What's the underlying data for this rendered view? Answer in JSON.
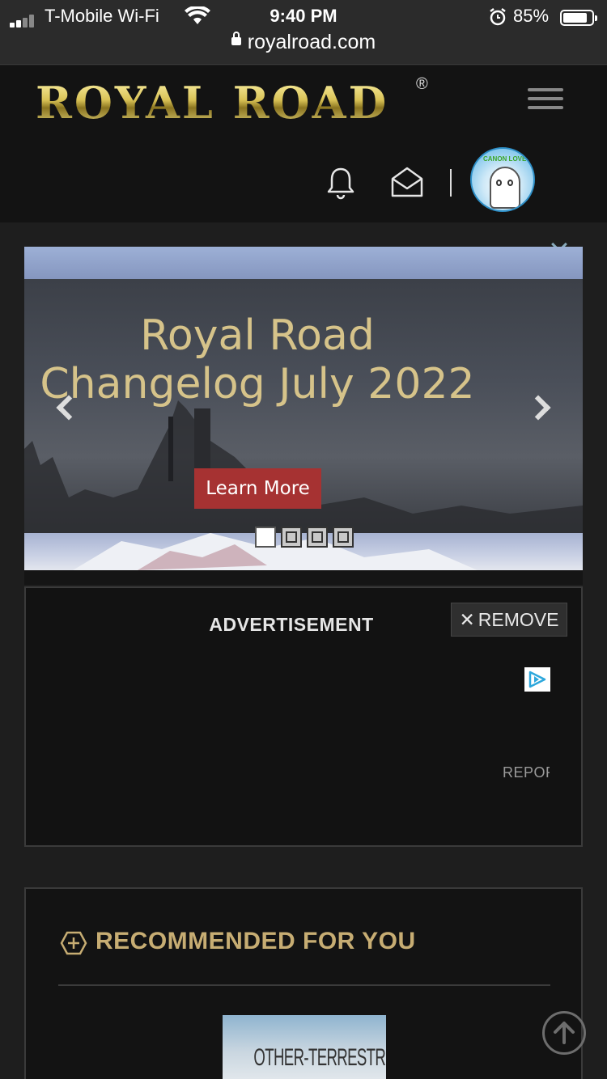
{
  "status_bar": {
    "carrier": "T-Mobile Wi-Fi",
    "time": "9:40 PM",
    "battery_percent": "85%",
    "battery_level": 0.85
  },
  "browser": {
    "url": "royalroad.com"
  },
  "header": {
    "logo_text": "ROYAL ROAD",
    "logo_mark": "®",
    "avatar_tag": "CANON LOVER"
  },
  "carousel": {
    "caption": "Royal Road Changelog July 2022",
    "button_label": "Learn More",
    "slide_count": 4,
    "active_slide": 1
  },
  "advertisement": {
    "title": "ADVERTISEMENT",
    "remove_label": "REMOVE",
    "report_label": "REPORT"
  },
  "recommended": {
    "title": "RECOMMENDED FOR YOU",
    "first_book_cover_text": "OTHER-TERRESTRIAL"
  },
  "colors": {
    "accent_gold": "#c7ad73",
    "button_red": "#a63232",
    "header_bg": "#131313",
    "page_bg": "#1e1e1e"
  },
  "icons": {
    "notification": "bell-icon",
    "messages": "envelope-icon",
    "menu": "hamburger-icon",
    "back_to_top": "arrow-up-icon"
  }
}
